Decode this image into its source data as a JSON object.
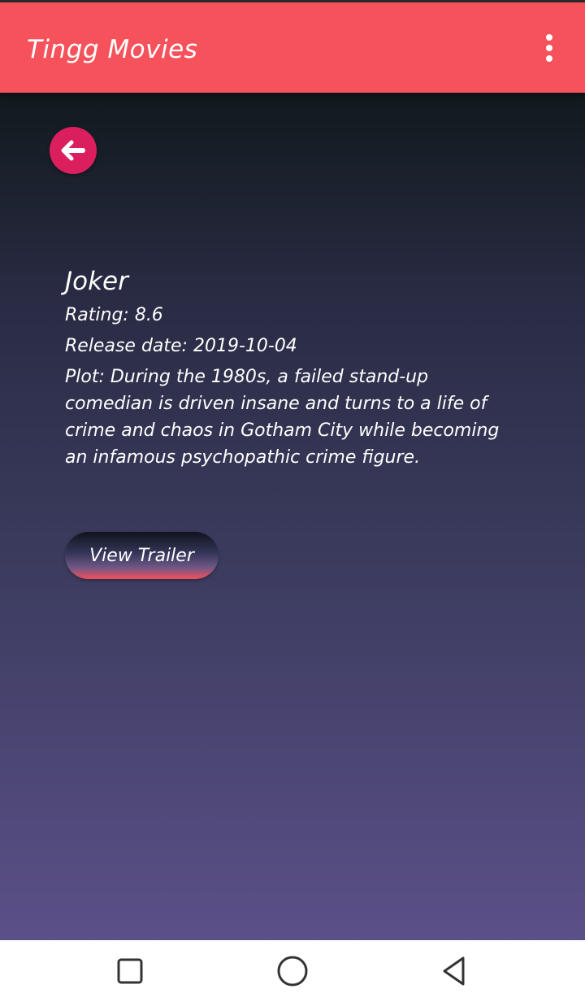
{
  "app_bar": {
    "title": "Tingg Movies",
    "menu_icon": "more-vert-icon"
  },
  "colors": {
    "app_bar": "#f5525b",
    "back_button": "#db1f5e",
    "gradient_top": "#11191d",
    "gradient_bottom": "#5b5088"
  },
  "back_button": {
    "icon": "arrow-left-icon"
  },
  "movie": {
    "title": "Joker",
    "rating": "Rating: 8.6",
    "release_date": "Release date: 2019-10-04",
    "plot": "Plot: During the 1980s, a failed stand-up comedian is driven insane and turns to a life of crime and chaos in Gotham City while becoming an infamous psychopathic crime figure."
  },
  "trailer_button": {
    "label": "View Trailer"
  },
  "nav_bar": {
    "icons": [
      "recents-square-icon",
      "home-circle-icon",
      "back-triangle-icon"
    ]
  }
}
